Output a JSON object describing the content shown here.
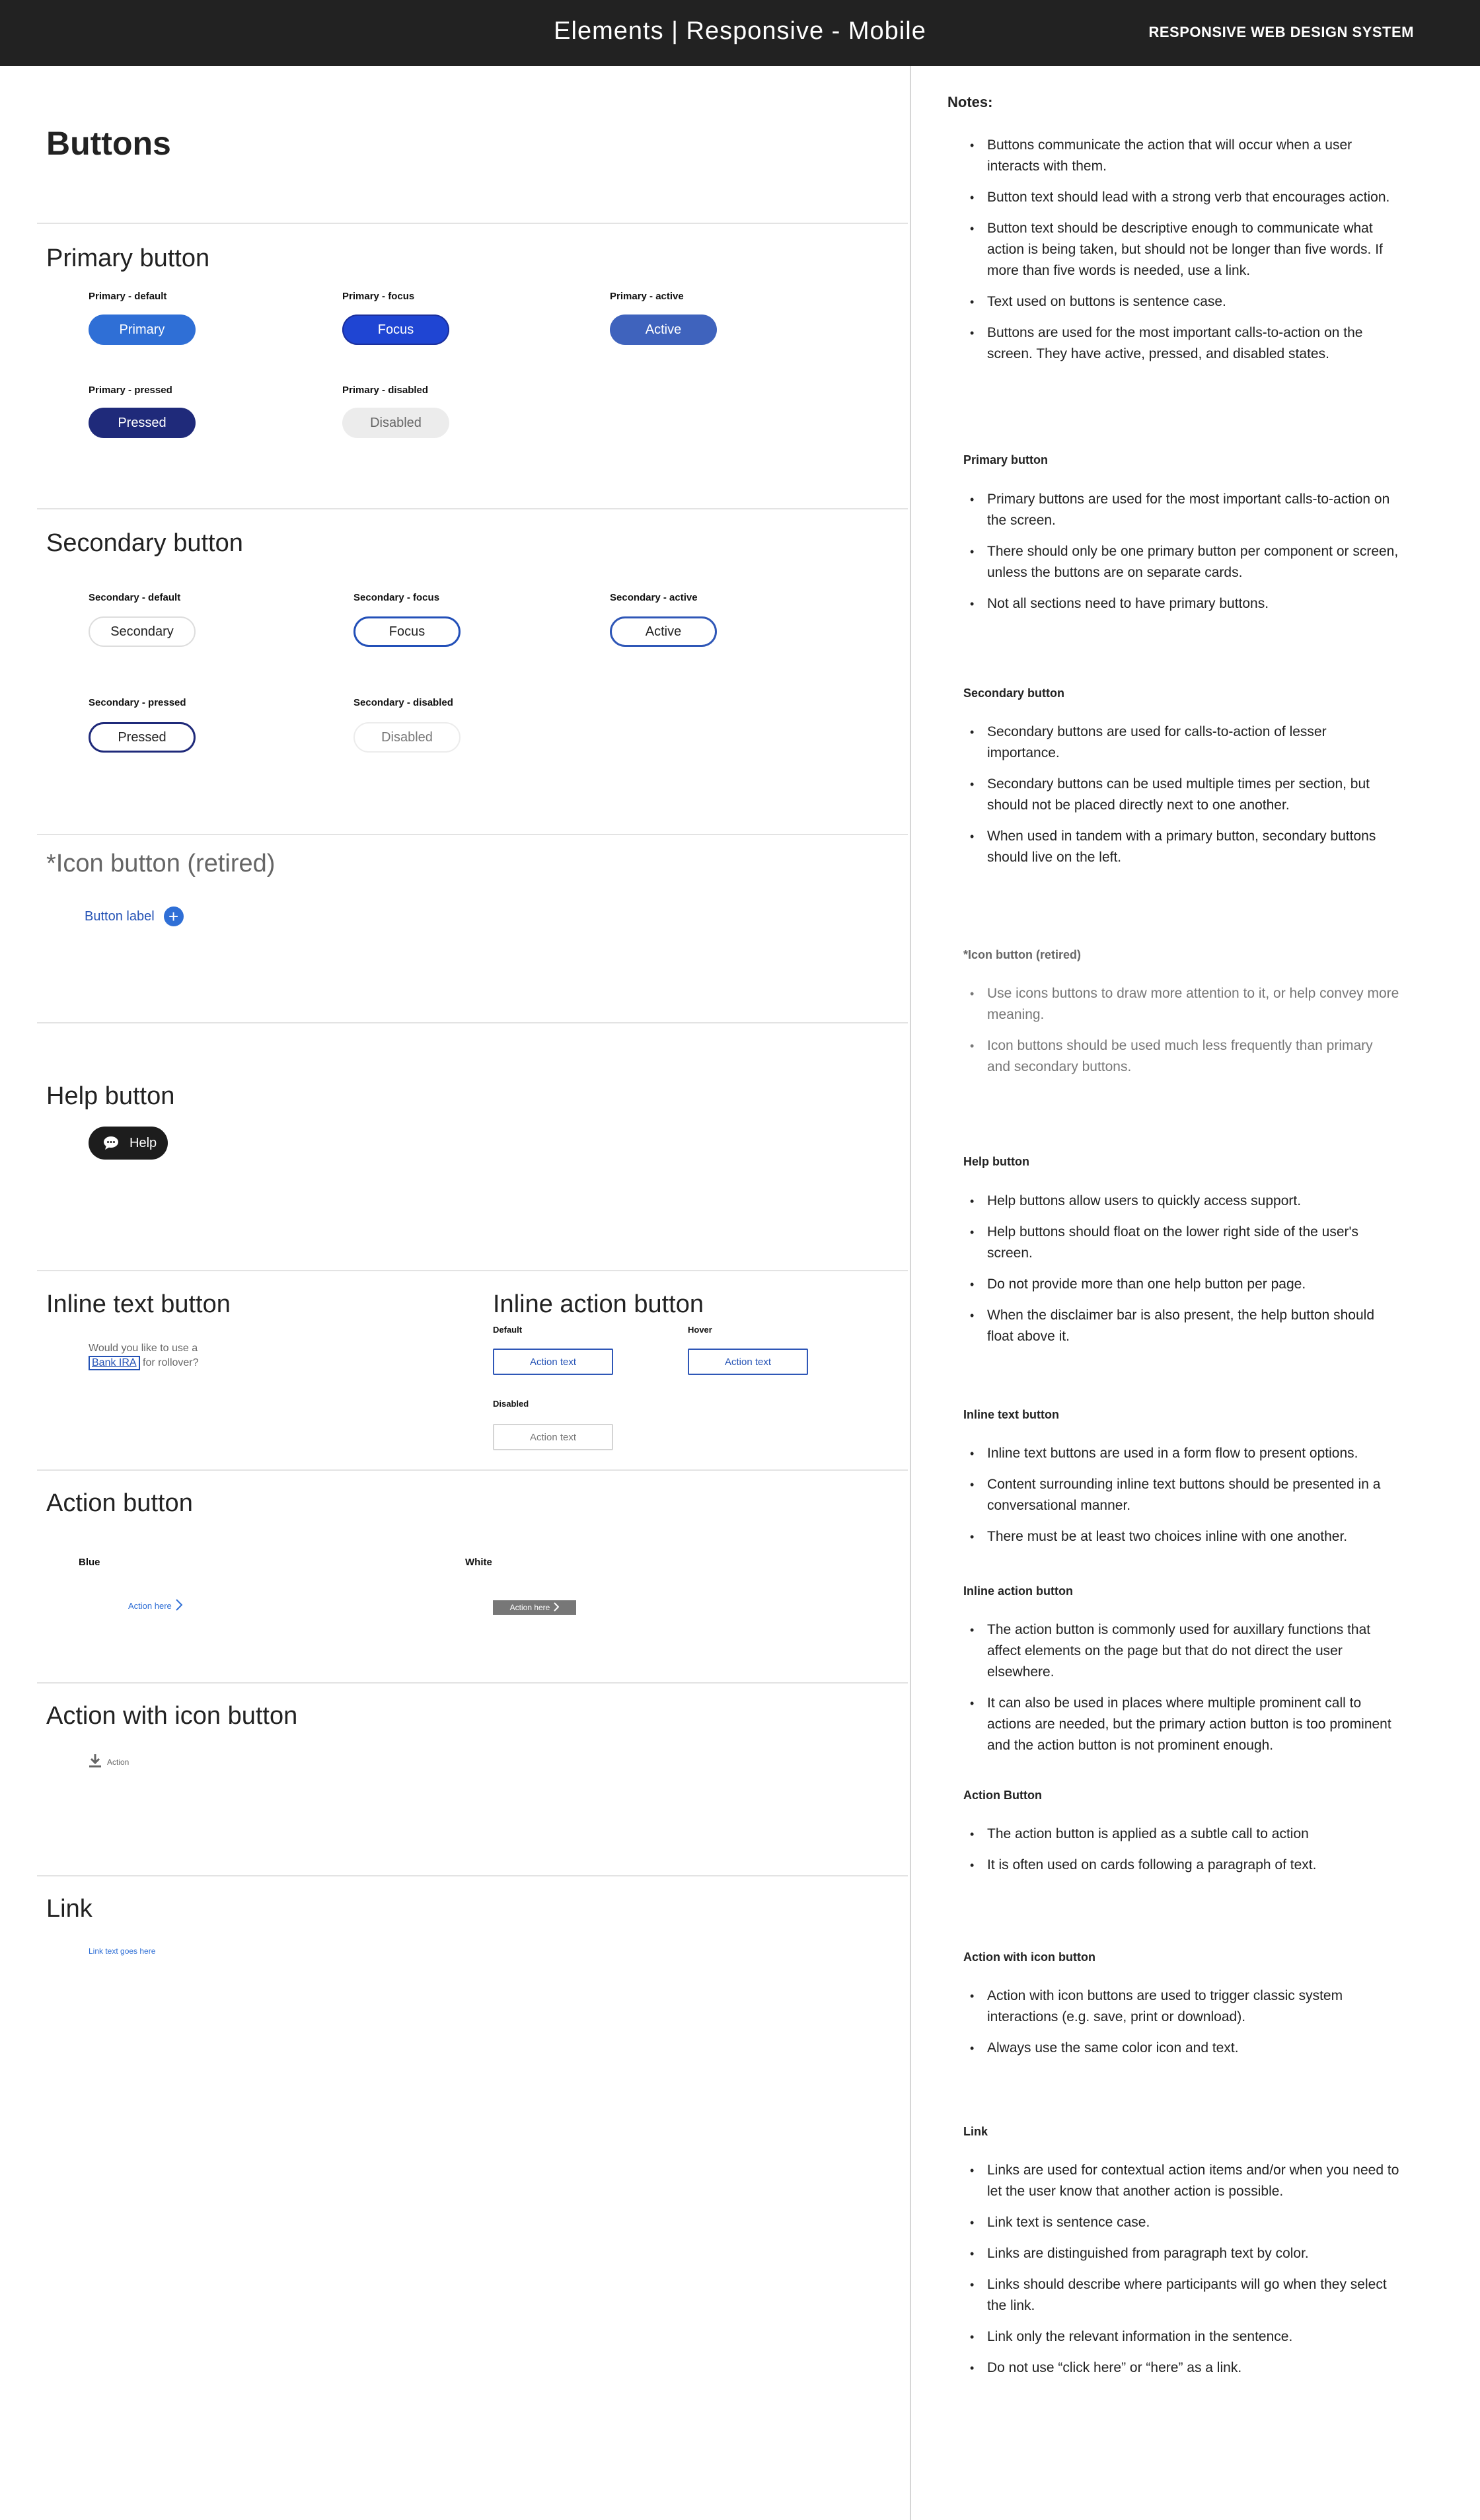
{
  "header": {
    "title": "Elements | Responsive - Mobile",
    "brand": "RESPONSIVE WEB DESIGN SYSTEM"
  },
  "page_heading": "Buttons",
  "primary": {
    "title": "Primary button",
    "default_label": "Primary - default",
    "default_text": "Primary",
    "focus_label": "Primary - focus",
    "focus_text": "Focus",
    "active_label": "Primary - active",
    "active_text": "Active",
    "pressed_label": "Primary - pressed",
    "pressed_text": "Pressed",
    "disabled_label": "Primary - disabled",
    "disabled_text": "Disabled"
  },
  "secondary": {
    "title": "Secondary button",
    "default_label": "Secondary - default",
    "default_text": "Secondary",
    "focus_label": "Secondary - focus",
    "focus_text": "Focus",
    "active_label": "Secondary - active",
    "active_text": "Active",
    "pressed_label": "Secondary - pressed",
    "pressed_text": "Pressed",
    "disabled_label": "Secondary - disabled",
    "disabled_text": "Disabled"
  },
  "icon_button": {
    "title": "*Icon button (retired)",
    "label": "Button label",
    "icon": "plus-circle-icon"
  },
  "help_button": {
    "title": "Help button",
    "text": "Help",
    "icon": "chat-bubble-icon"
  },
  "inline_text": {
    "title": "Inline text button",
    "line1": "Would you like to use a",
    "option": "Bank IRA",
    "line2_suffix": "for rollover?"
  },
  "inline_action": {
    "title": "Inline action button",
    "default_label": "Default",
    "hover_label": "Hover",
    "disabled_label": "Disabled",
    "button_text": "Action text"
  },
  "action_button": {
    "title": "Action button",
    "blue_label": "Blue",
    "white_label": "White",
    "text": "Action here"
  },
  "action_icon": {
    "title": "Action with icon button",
    "text": "Action",
    "icon": "download-icon"
  },
  "link": {
    "title": "Link",
    "text": "Link text goes here"
  },
  "notes": {
    "title": "Notes:",
    "general": [
      "Buttons communicate the action that will occur when a user interacts with them.",
      "Button text should lead with a strong verb that encourages action.",
      "Button text should be descriptive enough to communicate what action is being taken, but should not be longer than five words. If more than five words is needed, use a link.",
      "Text used on buttons is sentence case.",
      "Buttons are used for the most important calls-to-action on the screen. They have active, pressed, and disabled states."
    ],
    "primary_title": "Primary button",
    "primary": [
      "Primary buttons are used for the most important calls-to-action on the screen.",
      "There should only be one primary button per component or screen, unless the buttons are on separate cards.",
      "Not all sections need to have primary buttons."
    ],
    "secondary_title": "Secondary button",
    "secondary": [
      "Secondary buttons are used for calls-to-action of lesser importance.",
      "Secondary buttons can be used multiple times per section, but should not be placed directly next to one another.",
      "When used in tandem with a primary button, secondary buttons should live on the left."
    ],
    "icon_title": "*Icon button (retired)",
    "icon": [
      "Use icons buttons to draw more attention to it, or help convey more meaning.",
      "Icon buttons should be used much less frequently than primary and secondary buttons."
    ],
    "help_title": "Help button",
    "help": [
      "Help buttons allow users to quickly access support.",
      "Help buttons should float on the lower right side of the user's screen.",
      "Do not provide more than one help button per page.",
      "When the disclaimer bar is also present, the help button should float above it."
    ],
    "inline_text_title": "Inline text button",
    "inline_text": [
      "Inline text buttons are used in a form flow to present options.",
      "Content surrounding inline text buttons should be presented in a conversational manner.",
      "There must be at least two choices inline with one another."
    ],
    "inline_action_title": "Inline action button",
    "inline_action": [
      "The action button is commonly used for auxillary functions that affect elements on the page but that do not direct the user elsewhere.",
      "It can also be used in places where multiple prominent call to actions are needed, but the primary action button is too prominent and the action button is not prominent enough."
    ],
    "action_title": "Action Button",
    "action": [
      "The action button is applied as a subtle call to action",
      "It is often used on cards following a paragraph of text."
    ],
    "action_icon_title": "Action with icon button",
    "action_icon": [
      "Action with icon buttons are used to trigger classic system interactions (e.g. save, print or download).",
      "Always use the same color icon and text."
    ],
    "link_title": "Link",
    "link": [
      "Links are used for contextual action items and/or when you need to let the user know that another action is possible.",
      "Link text is sentence case.",
      "Links are distinguished from paragraph text by color.",
      "Links should describe where participants will go when they select the link.",
      "Link only the relevant information in the sentence.",
      "Do not use “click here” or “here” as a link."
    ]
  }
}
